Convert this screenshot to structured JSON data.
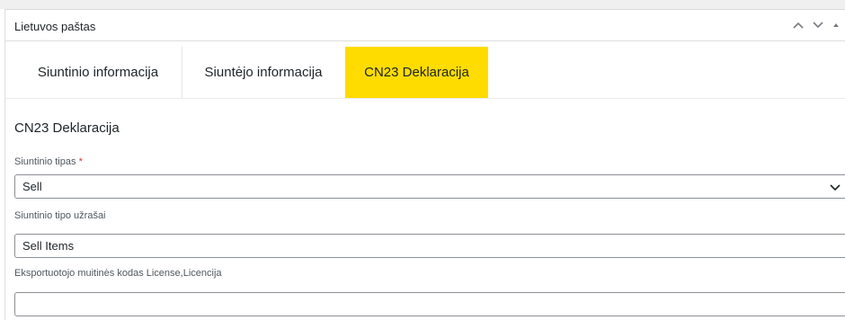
{
  "panel": {
    "title": "Lietuvos paštas",
    "move_up_label": "Move up",
    "move_down_label": "Move down",
    "toggle_label": "Toggle panel"
  },
  "tabs": [
    {
      "label": "Siuntinio informacija",
      "active": false
    },
    {
      "label": "Siuntėjo informacija",
      "active": false
    },
    {
      "label": "CN23 Deklaracija",
      "active": true
    }
  ],
  "section": {
    "title": "CN23 Deklaracija"
  },
  "fields": {
    "parcel_type": {
      "label": "Siuntinio tipas",
      "required_mark": "*",
      "value": "Sell"
    },
    "parcel_type_notes": {
      "label": "Siuntinio tipo užrašai",
      "value": "Sell Items"
    },
    "customs_code": {
      "label": "Eksportuotojo muitinės kodas License,Licencija",
      "value": ""
    }
  },
  "colors": {
    "active_tab": "#fedc00",
    "required": "#d63638",
    "border": "#8c8f94"
  }
}
